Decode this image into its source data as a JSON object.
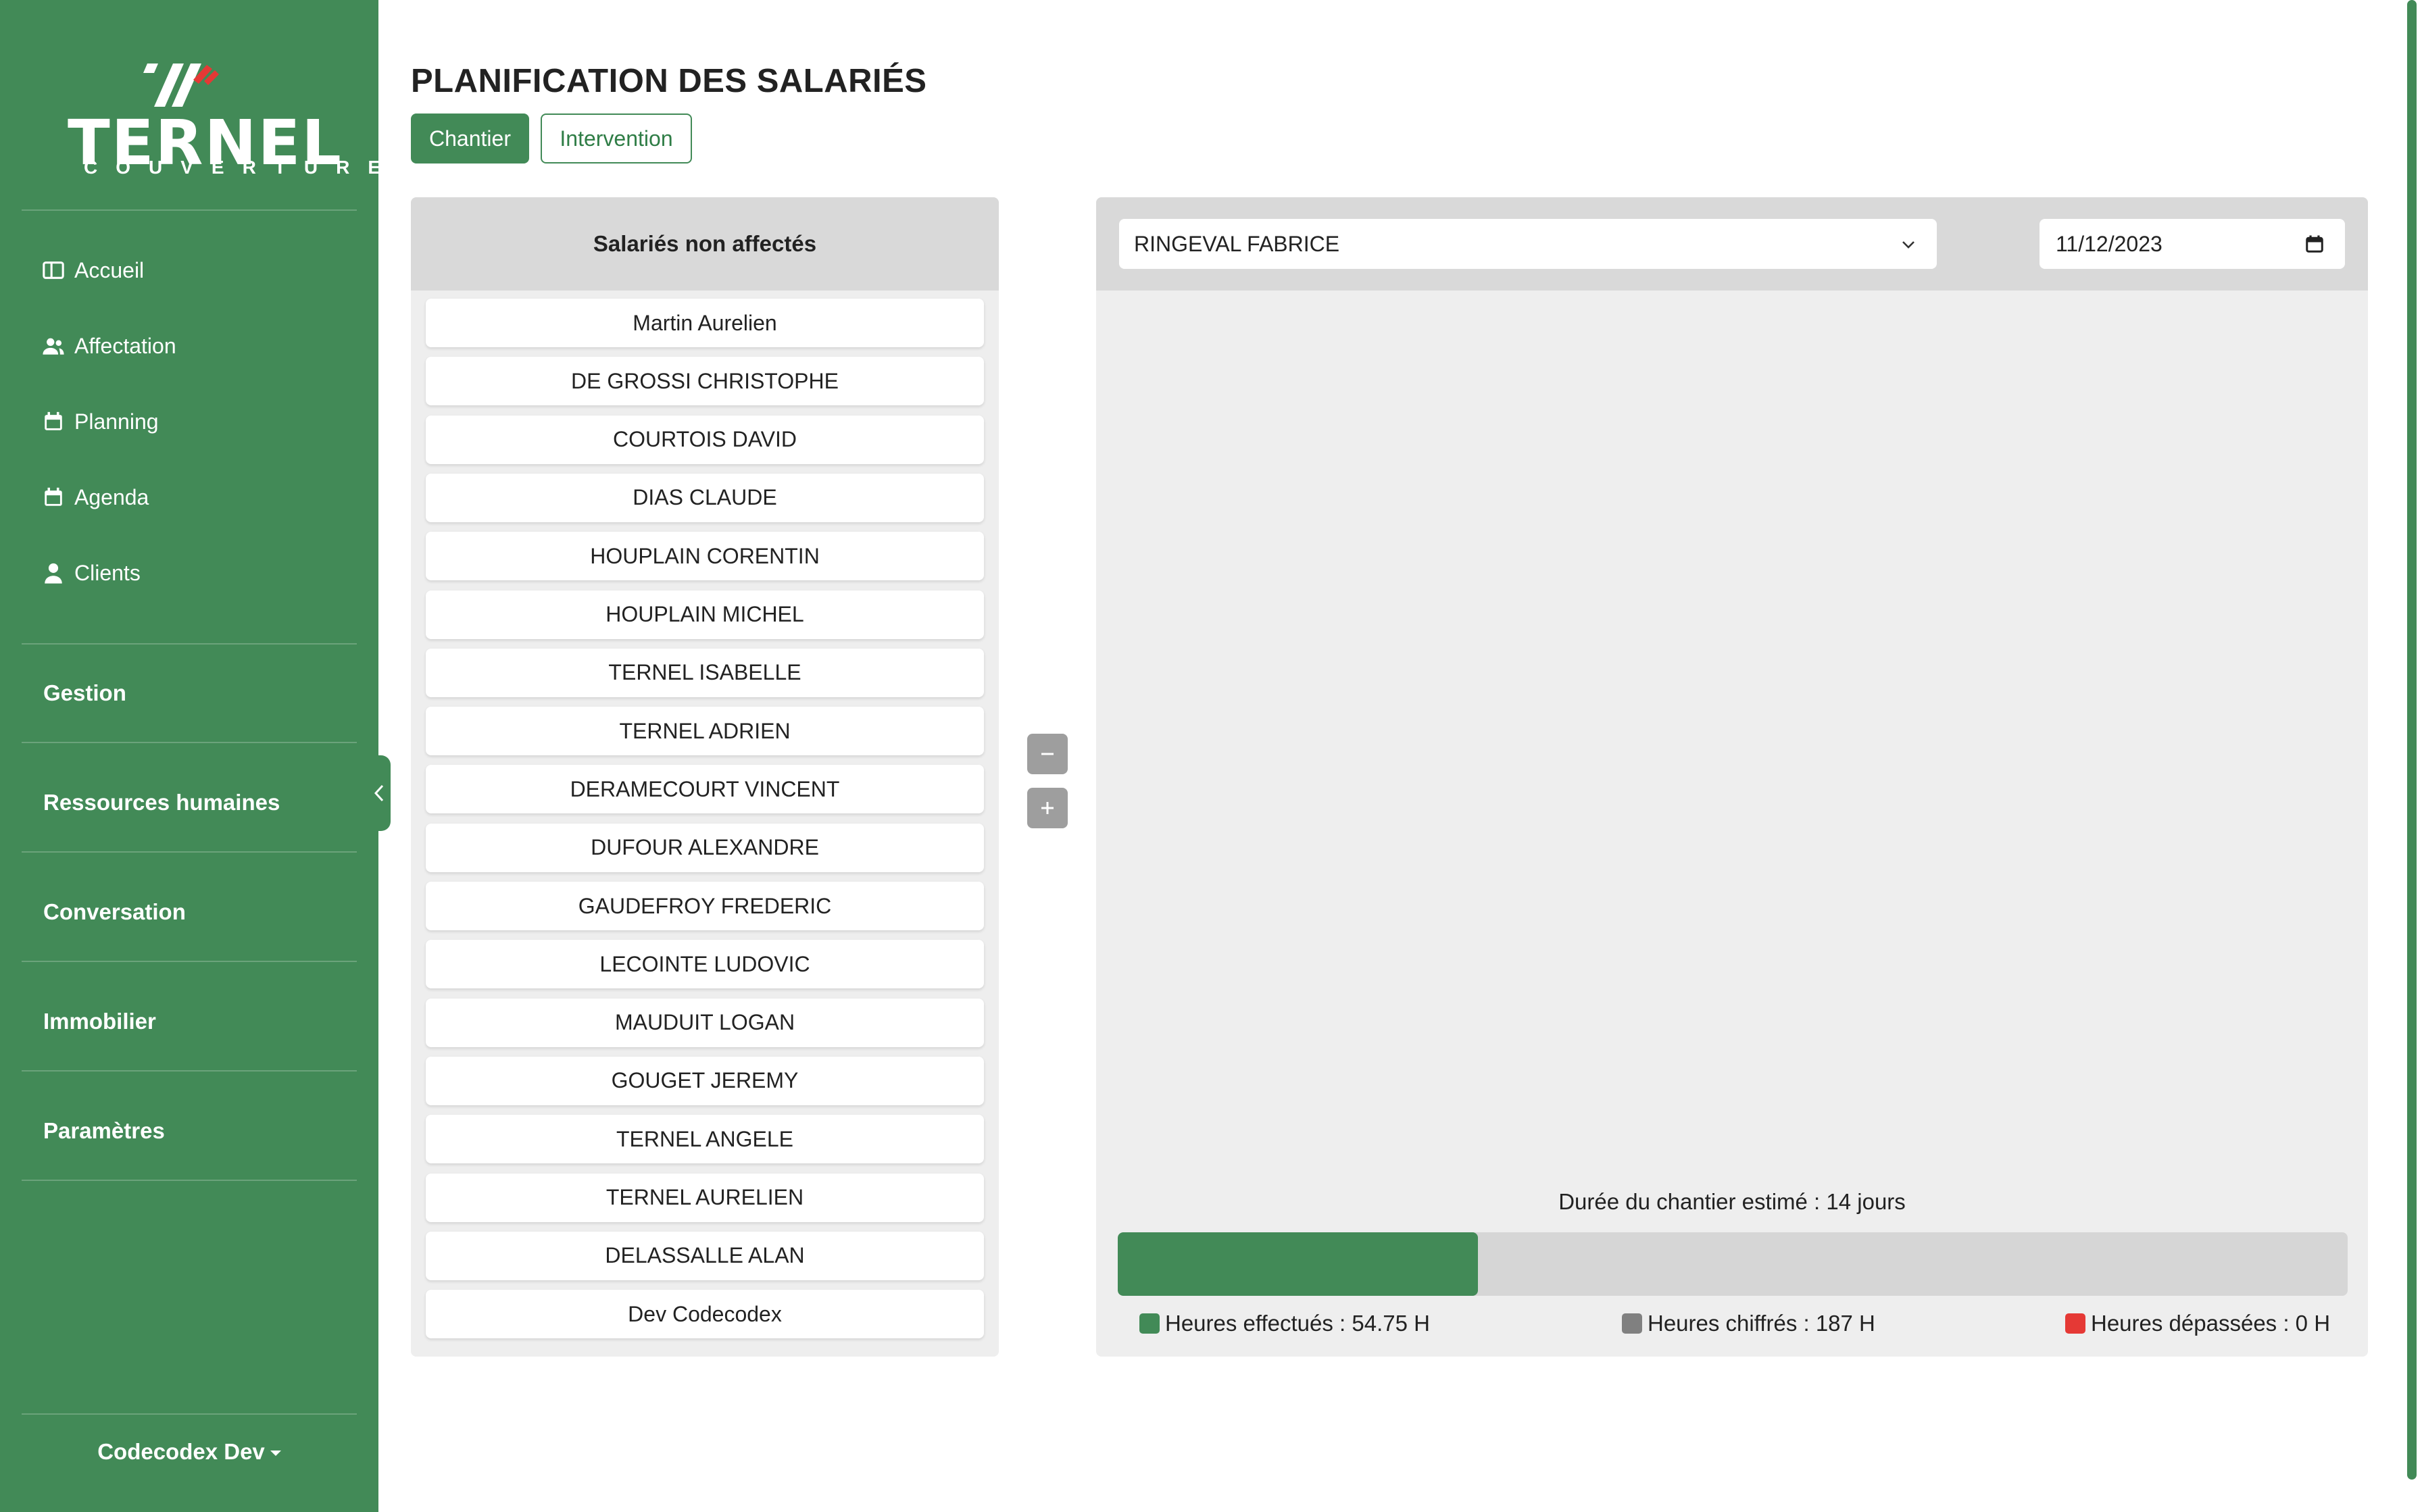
{
  "brand": {
    "word": "TERNEL",
    "sub": "COUVERTURE",
    "accent": "#428a57",
    "mark_color": "#e53935"
  },
  "sidebar": {
    "nav": [
      {
        "label": "Accueil",
        "icon": "layout-icon"
      },
      {
        "label": "Affectation",
        "icon": "users-icon"
      },
      {
        "label": "Planning",
        "icon": "calendar-icon"
      },
      {
        "label": "Agenda",
        "icon": "calendar-icon"
      },
      {
        "label": "Clients",
        "icon": "user-icon"
      }
    ],
    "sections": [
      "Gestion",
      "Ressources humaines",
      "Conversation",
      "Immobilier",
      "Paramètres"
    ],
    "user": "Codecodex Dev"
  },
  "page": {
    "title": "PLANIFICATION DES SALARIÉS",
    "tabs": [
      {
        "label": "Chantier",
        "active": true
      },
      {
        "label": "Intervention",
        "active": false
      }
    ]
  },
  "unassigned": {
    "title": "Salariés non affectés",
    "employees": [
      "Martin Aurelien",
      "DE GROSSI CHRISTOPHE",
      "COURTOIS DAVID",
      "DIAS CLAUDE",
      "HOUPLAIN CORENTIN",
      "HOUPLAIN MICHEL",
      "TERNEL ISABELLE",
      "TERNEL ADRIEN",
      "DERAMECOURT VINCENT",
      "DUFOUR ALEXANDRE",
      "GAUDEFROY FREDERIC",
      "LECOINTE LUDOVIC",
      "MAUDUIT LOGAN",
      "GOUGET JEREMY",
      "TERNEL ANGELE",
      "TERNEL AURELIEN",
      "DELASSALLE ALAN",
      "Dev Codecodex"
    ]
  },
  "zoom": {
    "minus_icon": "minus-icon",
    "plus_icon": "plus-icon"
  },
  "planning": {
    "selected_site": "RINGEVAL FABRICE",
    "date": "11/12/2023",
    "duration_text": "Durée du chantier estimé : 14 jours",
    "progress_fraction": 0.2928,
    "legend": [
      {
        "label": "Heures effectués : 54.75 H",
        "color": "#428a57"
      },
      {
        "label": "Heures chiffrés : 187 H",
        "color": "#808080"
      },
      {
        "label": "Heures dépassées : 0 H",
        "color": "#e53935"
      }
    ]
  }
}
